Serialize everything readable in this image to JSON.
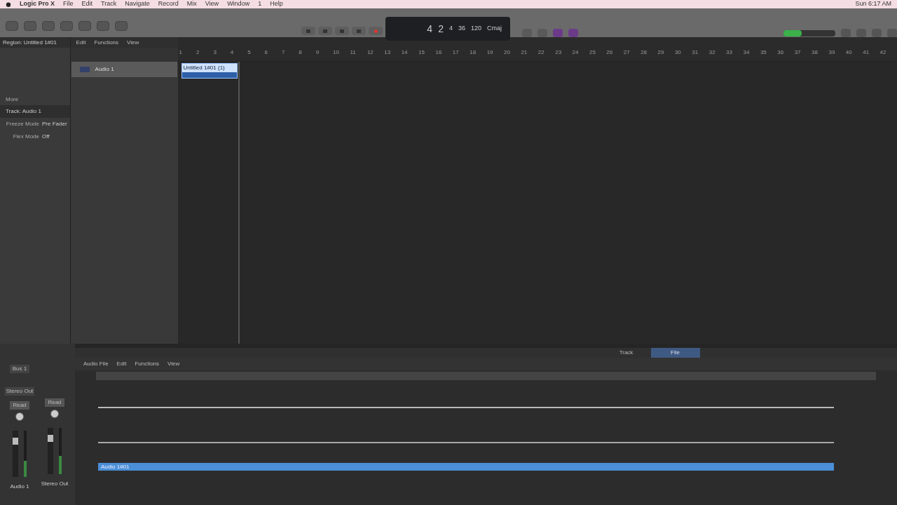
{
  "menu_bar": {
    "app": "Logic Pro X",
    "items": [
      "File",
      "Edit",
      "Track",
      "Navigate",
      "Record",
      "Mix",
      "View",
      "Window",
      "1",
      "Help"
    ],
    "clock": "Sun 6:17 AM"
  },
  "lcd": [
    "4",
    "2",
    "4",
    "36",
    "120",
    "Cmaj"
  ],
  "tracks_area": {
    "region_label": "Region: Untitled 1#01",
    "menu": [
      "Edit",
      "Functions",
      "View"
    ]
  },
  "inspector": {
    "rows": [
      {
        "kind": "label",
        "text": "More"
      },
      {
        "kind": "header",
        "text": "Track: Audio 1"
      },
      {
        "kind": "field",
        "label": "Freeze Mode",
        "value": "Pre Fader"
      },
      {
        "kind": "field",
        "label": "Flex Mode",
        "value": "Off"
      }
    ]
  },
  "tracks": [
    {
      "name": "Audio 1",
      "selected": true,
      "region": "Untitled 1#01 (1)"
    }
  ],
  "ruler": [
    "1",
    "2",
    "3",
    "4",
    "5",
    "6",
    "7",
    "8",
    "9",
    "10",
    "11",
    "12",
    "13",
    "14",
    "15",
    "16",
    "17",
    "18",
    "19",
    "20",
    "21",
    "22",
    "23",
    "24",
    "25",
    "26",
    "27",
    "28",
    "29",
    "30",
    "31",
    "32",
    "33",
    "34",
    "35",
    "36",
    "37",
    "38",
    "39",
    "40",
    "41",
    "42"
  ],
  "editor": {
    "tabs": [
      {
        "label": "Track",
        "selected": false
      },
      {
        "label": "File",
        "selected": true
      }
    ],
    "menu": [
      "Audio File",
      "Edit",
      "Functions",
      "View"
    ],
    "region": "Audio 1#01"
  },
  "mixer": [
    {
      "send": "Bus 1",
      "output": "Stereo Out",
      "automation": "Read",
      "name": "Audio 1",
      "level": 0.35
    },
    {
      "automation": "Read",
      "name": "Stereo Out",
      "level": 0.4
    }
  ]
}
